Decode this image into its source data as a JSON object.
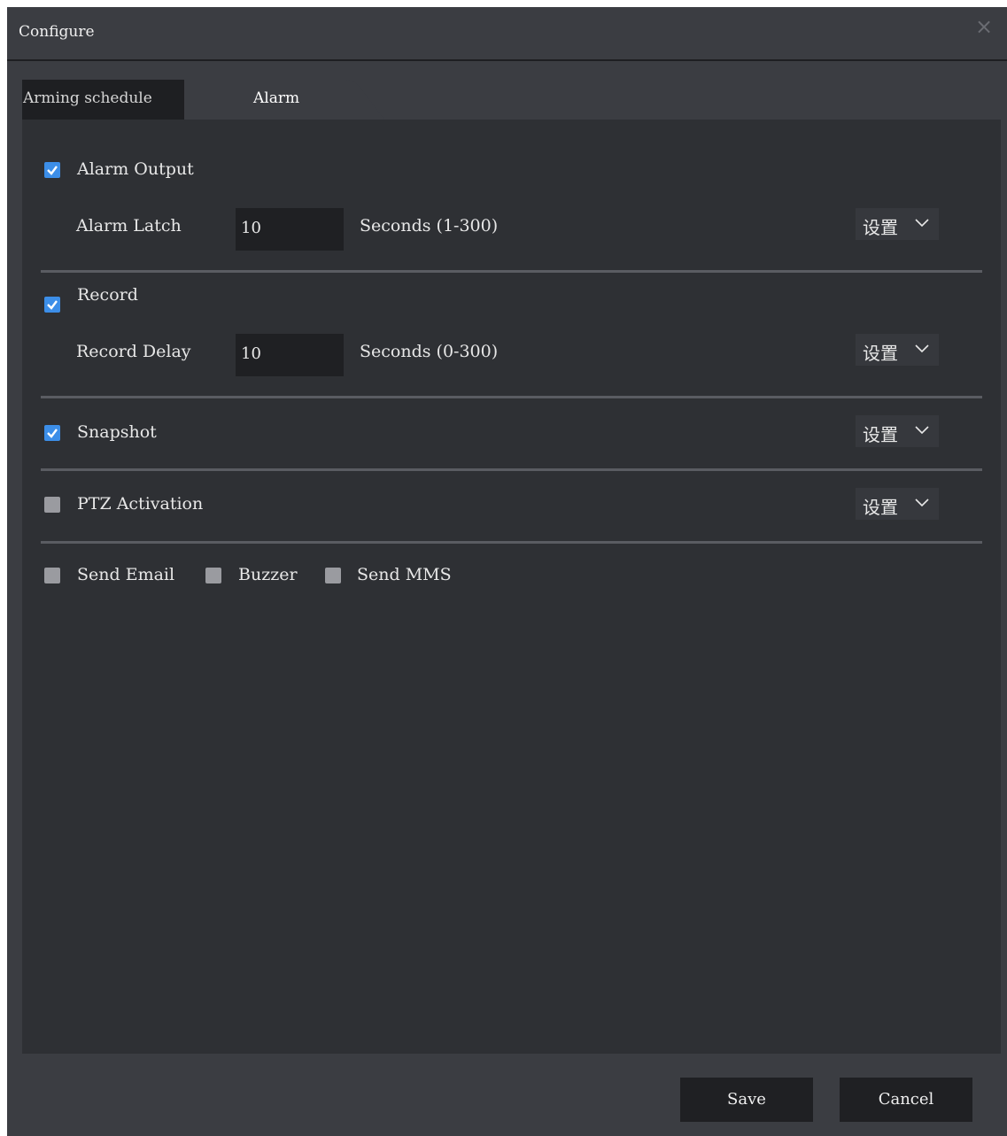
{
  "dialog": {
    "title": "Configure",
    "close_icon": "close-icon"
  },
  "tabs": [
    {
      "label": "Arming schedule",
      "active": false
    },
    {
      "label": "Alarm",
      "active": true
    }
  ],
  "alarm_output": {
    "label": "Alarm Output",
    "checked": true,
    "field_label": "Alarm Latch",
    "value": "10",
    "unit": "Seconds (1-300)",
    "settings_label": "设置"
  },
  "record": {
    "label": "Record",
    "checked": true,
    "field_label": "Record Delay",
    "value": "10",
    "unit": "Seconds (0-300)",
    "settings_label": "设置"
  },
  "snapshot": {
    "label": "Snapshot",
    "checked": true,
    "settings_label": "设置"
  },
  "ptz": {
    "label": "PTZ Activation",
    "checked": false,
    "settings_label": "设置"
  },
  "options": [
    {
      "label": "Send Email",
      "checked": false
    },
    {
      "label": "Buzzer",
      "checked": false
    },
    {
      "label": "Send MMS",
      "checked": false
    }
  ],
  "footer": {
    "save_label": "Save",
    "cancel_label": "Cancel"
  },
  "colors": {
    "accent": "#3c8ee8",
    "panel": "#2e3034",
    "dialog": "#3b3d42"
  }
}
